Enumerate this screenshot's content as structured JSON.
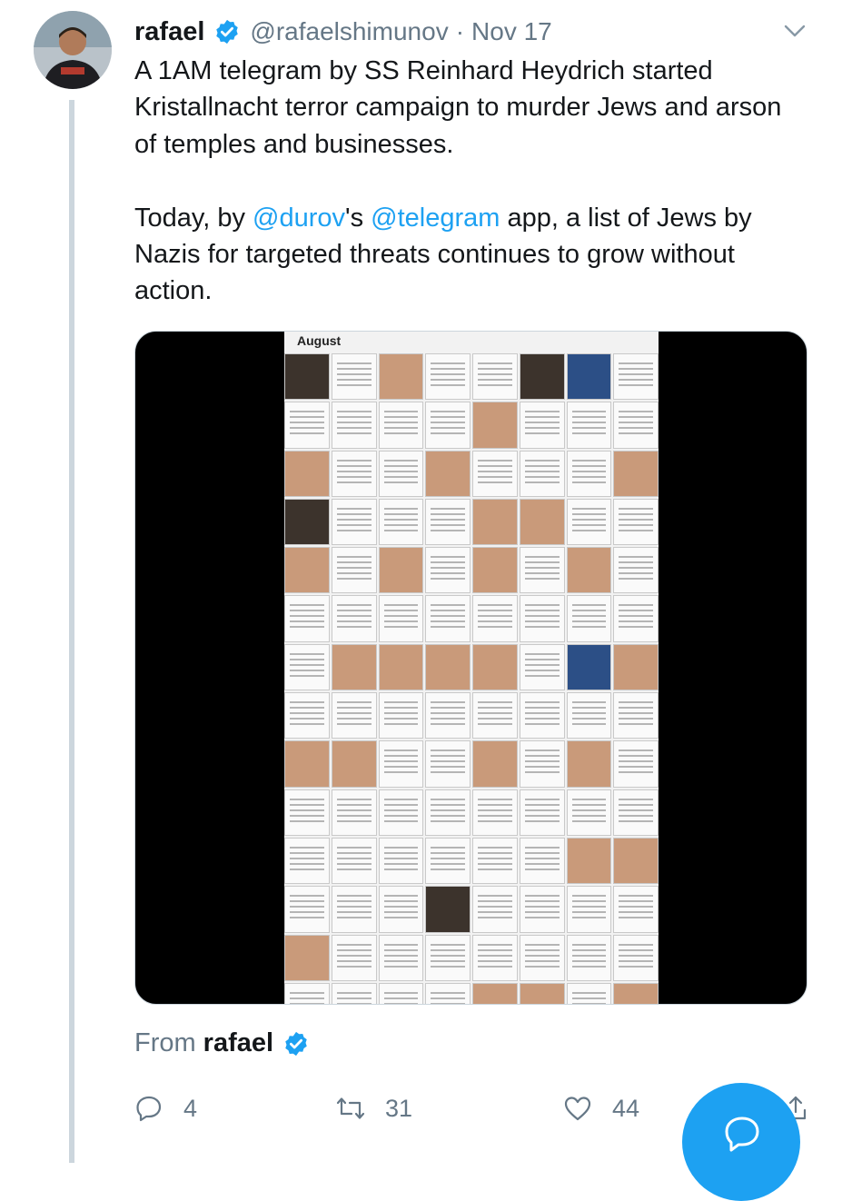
{
  "tweet": {
    "author_name": "rafael",
    "handle": "@rafaelshimunov",
    "separator": "·",
    "date": "Nov 17",
    "paragraph1": "A 1AM telegram by SS Reinhard Heydrich started Kristallnacht terror campaign to murder Jews and arson of temples and businesses.",
    "paragraph2": {
      "prefix": "Today, by ",
      "mention1": "@durov",
      "middle": "'s ",
      "mention2": "@telegram",
      "suffix": " app, a list of Jews by Nazis for targeted threats continues to grow without action."
    },
    "media": {
      "collage_title": "August"
    },
    "from_label": "From",
    "from_name": "rafael"
  },
  "actions": {
    "reply_count": "4",
    "retweet_count": "31",
    "like_count": "44"
  },
  "icons": {
    "verified": "verified-badge-icon",
    "caret": "chevron-down-icon",
    "reply": "reply-icon",
    "retweet": "retweet-icon",
    "like": "heart-icon",
    "share": "share-icon",
    "compose": "compose-reply-icon"
  },
  "colors": {
    "accent": "#1da1f2",
    "text": "#14171a",
    "secondary": "#657786",
    "thread_line": "#ccd6dd"
  }
}
